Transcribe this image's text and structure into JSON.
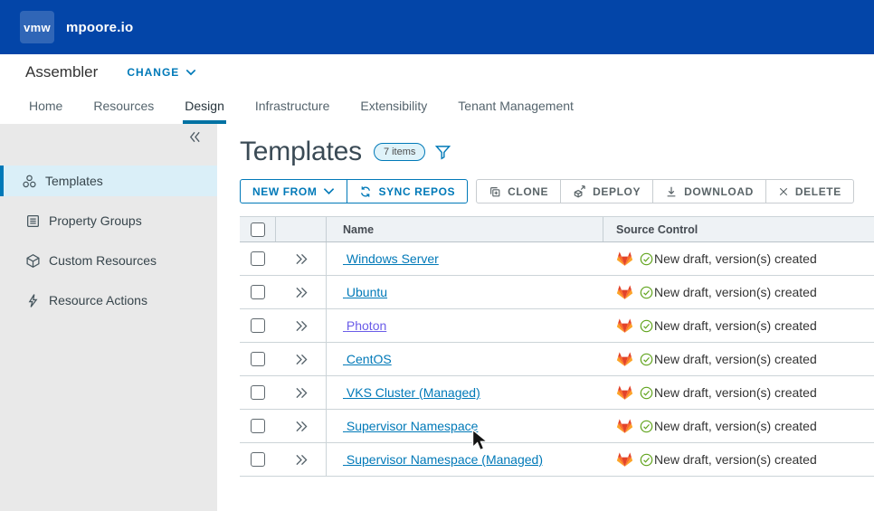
{
  "topbar": {
    "logo_text": "vmw",
    "brand": "mpoore.io"
  },
  "app_header": {
    "app_name": "Assembler",
    "change_label": "CHANGE"
  },
  "tabs": [
    {
      "label": "Home",
      "active": false
    },
    {
      "label": "Resources",
      "active": false
    },
    {
      "label": "Design",
      "active": true
    },
    {
      "label": "Infrastructure",
      "active": false
    },
    {
      "label": "Extensibility",
      "active": false
    },
    {
      "label": "Tenant Management",
      "active": false
    }
  ],
  "sidebar": {
    "items": [
      {
        "label": "Templates",
        "icon": "templates-icon",
        "selected": true
      },
      {
        "label": "Property Groups",
        "icon": "property-groups-icon",
        "selected": false
      },
      {
        "label": "Custom Resources",
        "icon": "custom-resources-icon",
        "selected": false
      },
      {
        "label": "Resource Actions",
        "icon": "resource-actions-icon",
        "selected": false
      }
    ]
  },
  "page": {
    "title": "Templates",
    "count_badge": "7 items"
  },
  "toolbar": {
    "primary_buttons": [
      {
        "label": "NEW FROM",
        "icon": "chevron-down-icon",
        "icon_position": "right"
      },
      {
        "label": "SYNC REPOS",
        "icon": "sync-icon",
        "icon_position": "left"
      }
    ],
    "secondary_buttons": [
      {
        "label": "CLONE",
        "icon": "clone-icon"
      },
      {
        "label": "DEPLOY",
        "icon": "deploy-icon"
      },
      {
        "label": "DOWNLOAD",
        "icon": "download-icon"
      },
      {
        "label": "DELETE",
        "icon": "delete-icon"
      }
    ]
  },
  "table": {
    "columns": {
      "name": "Name",
      "source_control": "Source Control"
    },
    "rows": [
      {
        "name": "Windows Server",
        "status": "New draft, version(s) created",
        "visited": false
      },
      {
        "name": "Ubuntu",
        "status": "New draft, version(s) created",
        "visited": false
      },
      {
        "name": "Photon",
        "status": "New draft, version(s) created",
        "visited": true
      },
      {
        "name": "CentOS",
        "status": "New draft, version(s) created",
        "visited": false
      },
      {
        "name": "VKS Cluster (Managed)",
        "status": "New draft, version(s) created",
        "visited": false
      },
      {
        "name": "Supervisor Namespace",
        "status": "New draft, version(s) created",
        "visited": false
      },
      {
        "name": "Supervisor Namespace (Managed)",
        "status": "New draft, version(s) created",
        "visited": false
      }
    ]
  },
  "colors": {
    "topbar_bg": "#0345a8",
    "accent_blue": "#0079b8",
    "visited_link": "#6a5ce8",
    "active_tab_underline": "#0072a3",
    "sidebar_bg": "#e9e9e9",
    "selected_item_bg": "#daeff8",
    "gitlab_red": "#e24329",
    "gitlab_orange": "#fc6d26",
    "gitlab_yellow": "#fca326",
    "status_green": "#61a41e"
  }
}
